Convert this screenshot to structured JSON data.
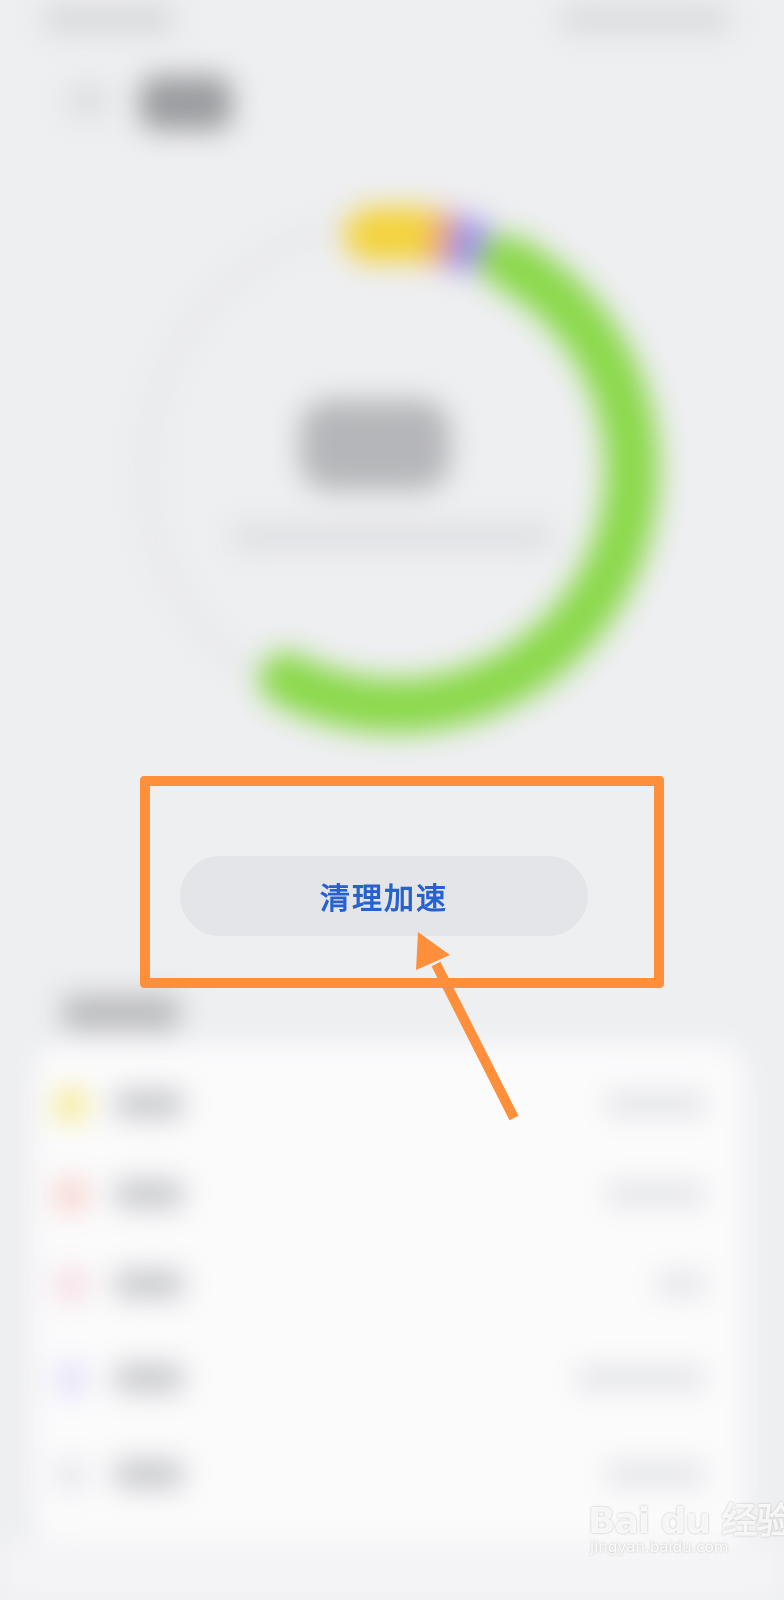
{
  "action": {
    "clean_label": "清理加速"
  },
  "watermark": {
    "brand": "Bai du 经验",
    "url": "jingyan.baidu.com"
  },
  "colors": {
    "ring_green": "#8ad84a",
    "ring_yellow": "#f3d23a",
    "ring_purple": "#9b8ff0",
    "ring_pink": "#ee9b9b",
    "button_text": "#2561cf",
    "annotation": "#ff8f3a",
    "background": "#eeeff1"
  },
  "storage_rows": [
    {
      "dot_color": "#f4e98a"
    },
    {
      "dot_color": "#f6cfc8"
    },
    {
      "dot_color": "#f4d9e0"
    },
    {
      "dot_color": "#e2def7"
    },
    {
      "dot_color": "#e6e7ea"
    }
  ]
}
